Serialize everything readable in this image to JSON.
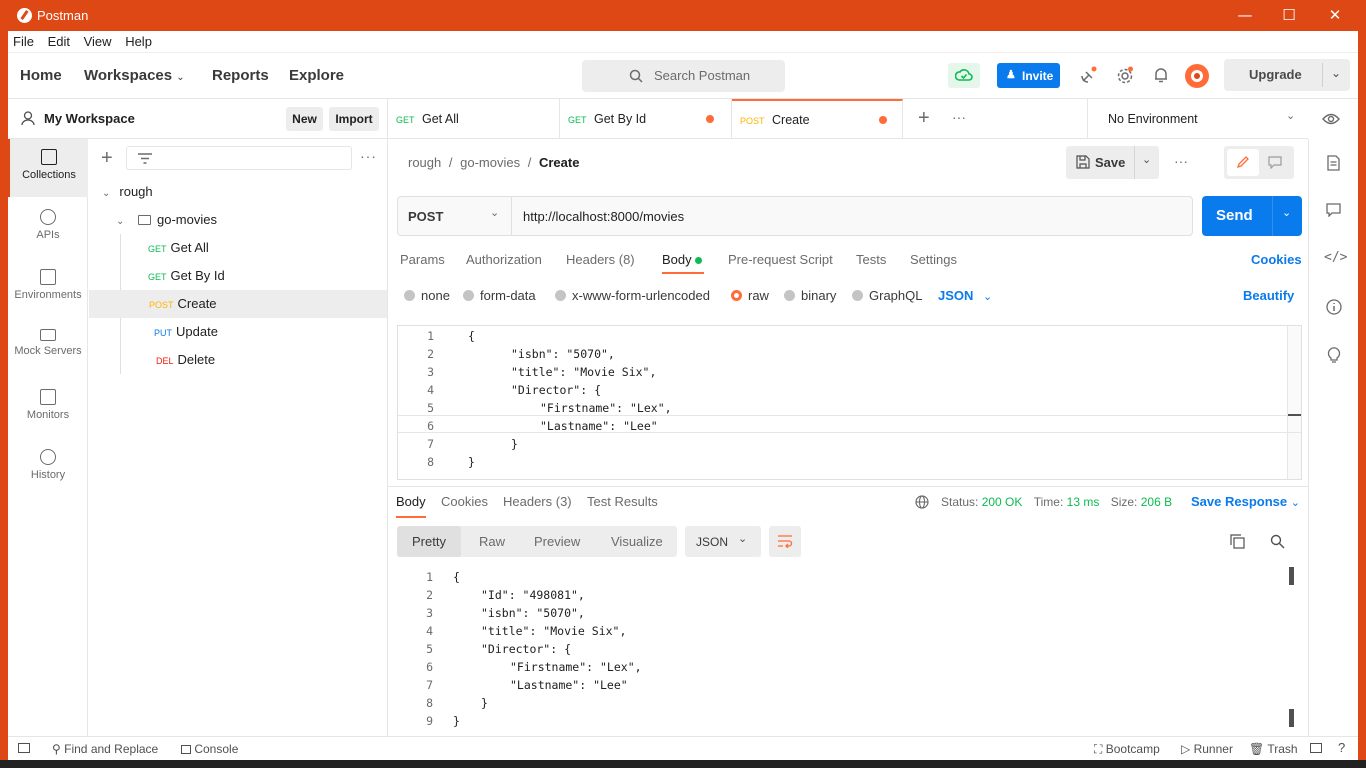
{
  "window": {
    "title": "Postman",
    "minimize": "—",
    "maximize": "☐",
    "close": "✕"
  },
  "menu": [
    "File",
    "Edit",
    "View",
    "Help"
  ],
  "header": {
    "home": "Home",
    "workspaces": "Workspaces",
    "reports": "Reports",
    "explore": "Explore",
    "search_placeholder": "Search Postman",
    "invite": "Invite",
    "upgrade": "Upgrade"
  },
  "workspace": {
    "name": "My Workspace",
    "new_label": "New",
    "import_label": "Import"
  },
  "rail": [
    {
      "label": "Collections",
      "icon": "collections-icon"
    },
    {
      "label": "APIs",
      "icon": "apis-icon"
    },
    {
      "label": "Environments",
      "icon": "environments-icon"
    },
    {
      "label": "Mock Servers",
      "icon": "mock-servers-icon"
    },
    {
      "label": "Monitors",
      "icon": "monitors-icon"
    },
    {
      "label": "History",
      "icon": "history-icon"
    }
  ],
  "tree": {
    "collection": "rough",
    "folder": "go-movies",
    "requests": [
      {
        "method": "GET",
        "name": "Get All"
      },
      {
        "method": "GET",
        "name": "Get By Id"
      },
      {
        "method": "POST",
        "name": "Create"
      },
      {
        "method": "PUT",
        "name": "Update"
      },
      {
        "method": "DEL",
        "name": "Delete"
      }
    ]
  },
  "tabs": [
    {
      "method": "GET",
      "name": "Get All"
    },
    {
      "method": "GET",
      "name": "Get By Id"
    },
    {
      "method": "POST",
      "name": "Create"
    }
  ],
  "environment": "No Environment",
  "breadcrumb": {
    "collection": "rough",
    "folder": "go-movies",
    "request": "Create",
    "sep": "/"
  },
  "save_label": "Save",
  "request": {
    "method": "POST",
    "url": "http://localhost:8000/movies",
    "send_label": "Send",
    "tabs": [
      "Params",
      "Authorization",
      "Headers (8)",
      "Body",
      "Pre-request Script",
      "Tests",
      "Settings"
    ],
    "cookies_label": "Cookies",
    "body_types": [
      "none",
      "form-data",
      "x-www-form-urlencoded",
      "raw",
      "binary",
      "GraphQL"
    ],
    "body_format": "JSON",
    "beautify_label": "Beautify",
    "body_lines": [
      "{",
      "\"isbn\": \"5070\",",
      "\"title\": \"Movie Six\",",
      "\"Director\": {",
      "\"Firstname\": \"Lex\",",
      "\"Lastname\": \"Lee\"",
      "}",
      "}"
    ]
  },
  "response": {
    "tabs": [
      "Body",
      "Cookies",
      "Headers (3)",
      "Test Results"
    ],
    "status_label": "Status:",
    "status": "200 OK",
    "time_label": "Time:",
    "time": "13 ms",
    "size_label": "Size:",
    "size": "206 B",
    "save_response": "Save Response",
    "views": [
      "Pretty",
      "Raw",
      "Preview",
      "Visualize"
    ],
    "format": "JSON",
    "body_lines": [
      "{",
      "\"Id\": \"498081\",",
      "\"isbn\": \"5070\",",
      "\"title\": \"Movie Six\",",
      "\"Director\": {",
      "\"Firstname\": \"Lex\",",
      "\"Lastname\": \"Lee\"",
      "}",
      "}"
    ]
  },
  "statusbar": {
    "find_replace": "Find and Replace",
    "console": "Console",
    "bootcamp": "Bootcamp",
    "runner": "Runner",
    "trash": "Trash"
  },
  "colors": {
    "brand": "#dd4814",
    "accent": "#097bed",
    "status_ok": "#0cbb52",
    "method_get": "#0cbb52",
    "method_post": "#ffb400",
    "method_put": "#097bed",
    "method_del": "#eb2013"
  }
}
